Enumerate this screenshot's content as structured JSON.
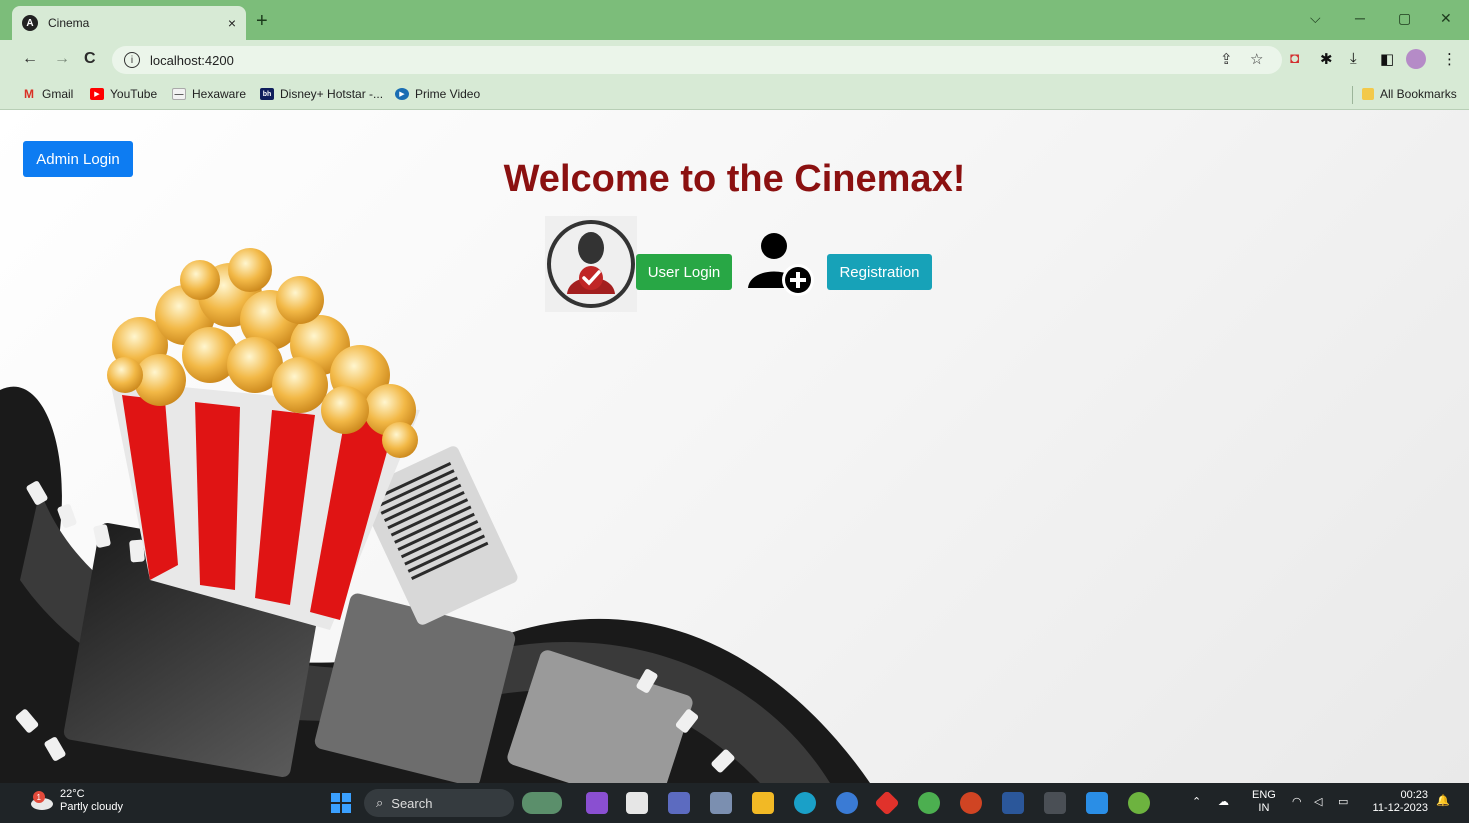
{
  "browser": {
    "tab_title": "Cinema",
    "tab_favicon": "A",
    "close_glyph": "×",
    "new_tab_glyph": "+",
    "url": "localhost:4200",
    "window_controls": [
      "⌵",
      "─",
      "▢",
      "✕"
    ],
    "nav": {
      "back": "←",
      "forward": "→",
      "reload": "C"
    },
    "info_glyph": "i"
  },
  "bookmarks": {
    "items": [
      {
        "label": "Gmail",
        "icon": "gmail-icon",
        "glyph": "M",
        "color": "#d93025"
      },
      {
        "label": "YouTube",
        "icon": "youtube-icon",
        "glyph": "▶",
        "color": "#ff0000"
      },
      {
        "label": "Hexaware",
        "icon": "hexaware-icon",
        "glyph": "—",
        "color": "#6b6b6b"
      },
      {
        "label": "Disney+ Hotstar -...",
        "icon": "hotstar-icon",
        "glyph": "bh",
        "color": "#0f1e5c"
      },
      {
        "label": "Prime Video",
        "icon": "prime-video-icon",
        "glyph": "▶",
        "color": "#1a6db3"
      }
    ],
    "all_bookmarks": "All Bookmarks"
  },
  "page": {
    "admin_button": "Admin Login",
    "heading": "Welcome to the Cinemax!",
    "user_login_button": "User Login",
    "registration_button": "Registration",
    "colors": {
      "heading": "#8b1111",
      "admin": "#0d7cf2",
      "user_login": "#28a745",
      "registration": "#17a2b8"
    }
  },
  "taskbar": {
    "weather_temp": "22°C",
    "weather_desc": "Partly cloudy",
    "weather_badge": "1",
    "search_label": "Search",
    "lang": "ENG",
    "region": "IN",
    "time": "00:23",
    "date": "11-12-2023"
  }
}
